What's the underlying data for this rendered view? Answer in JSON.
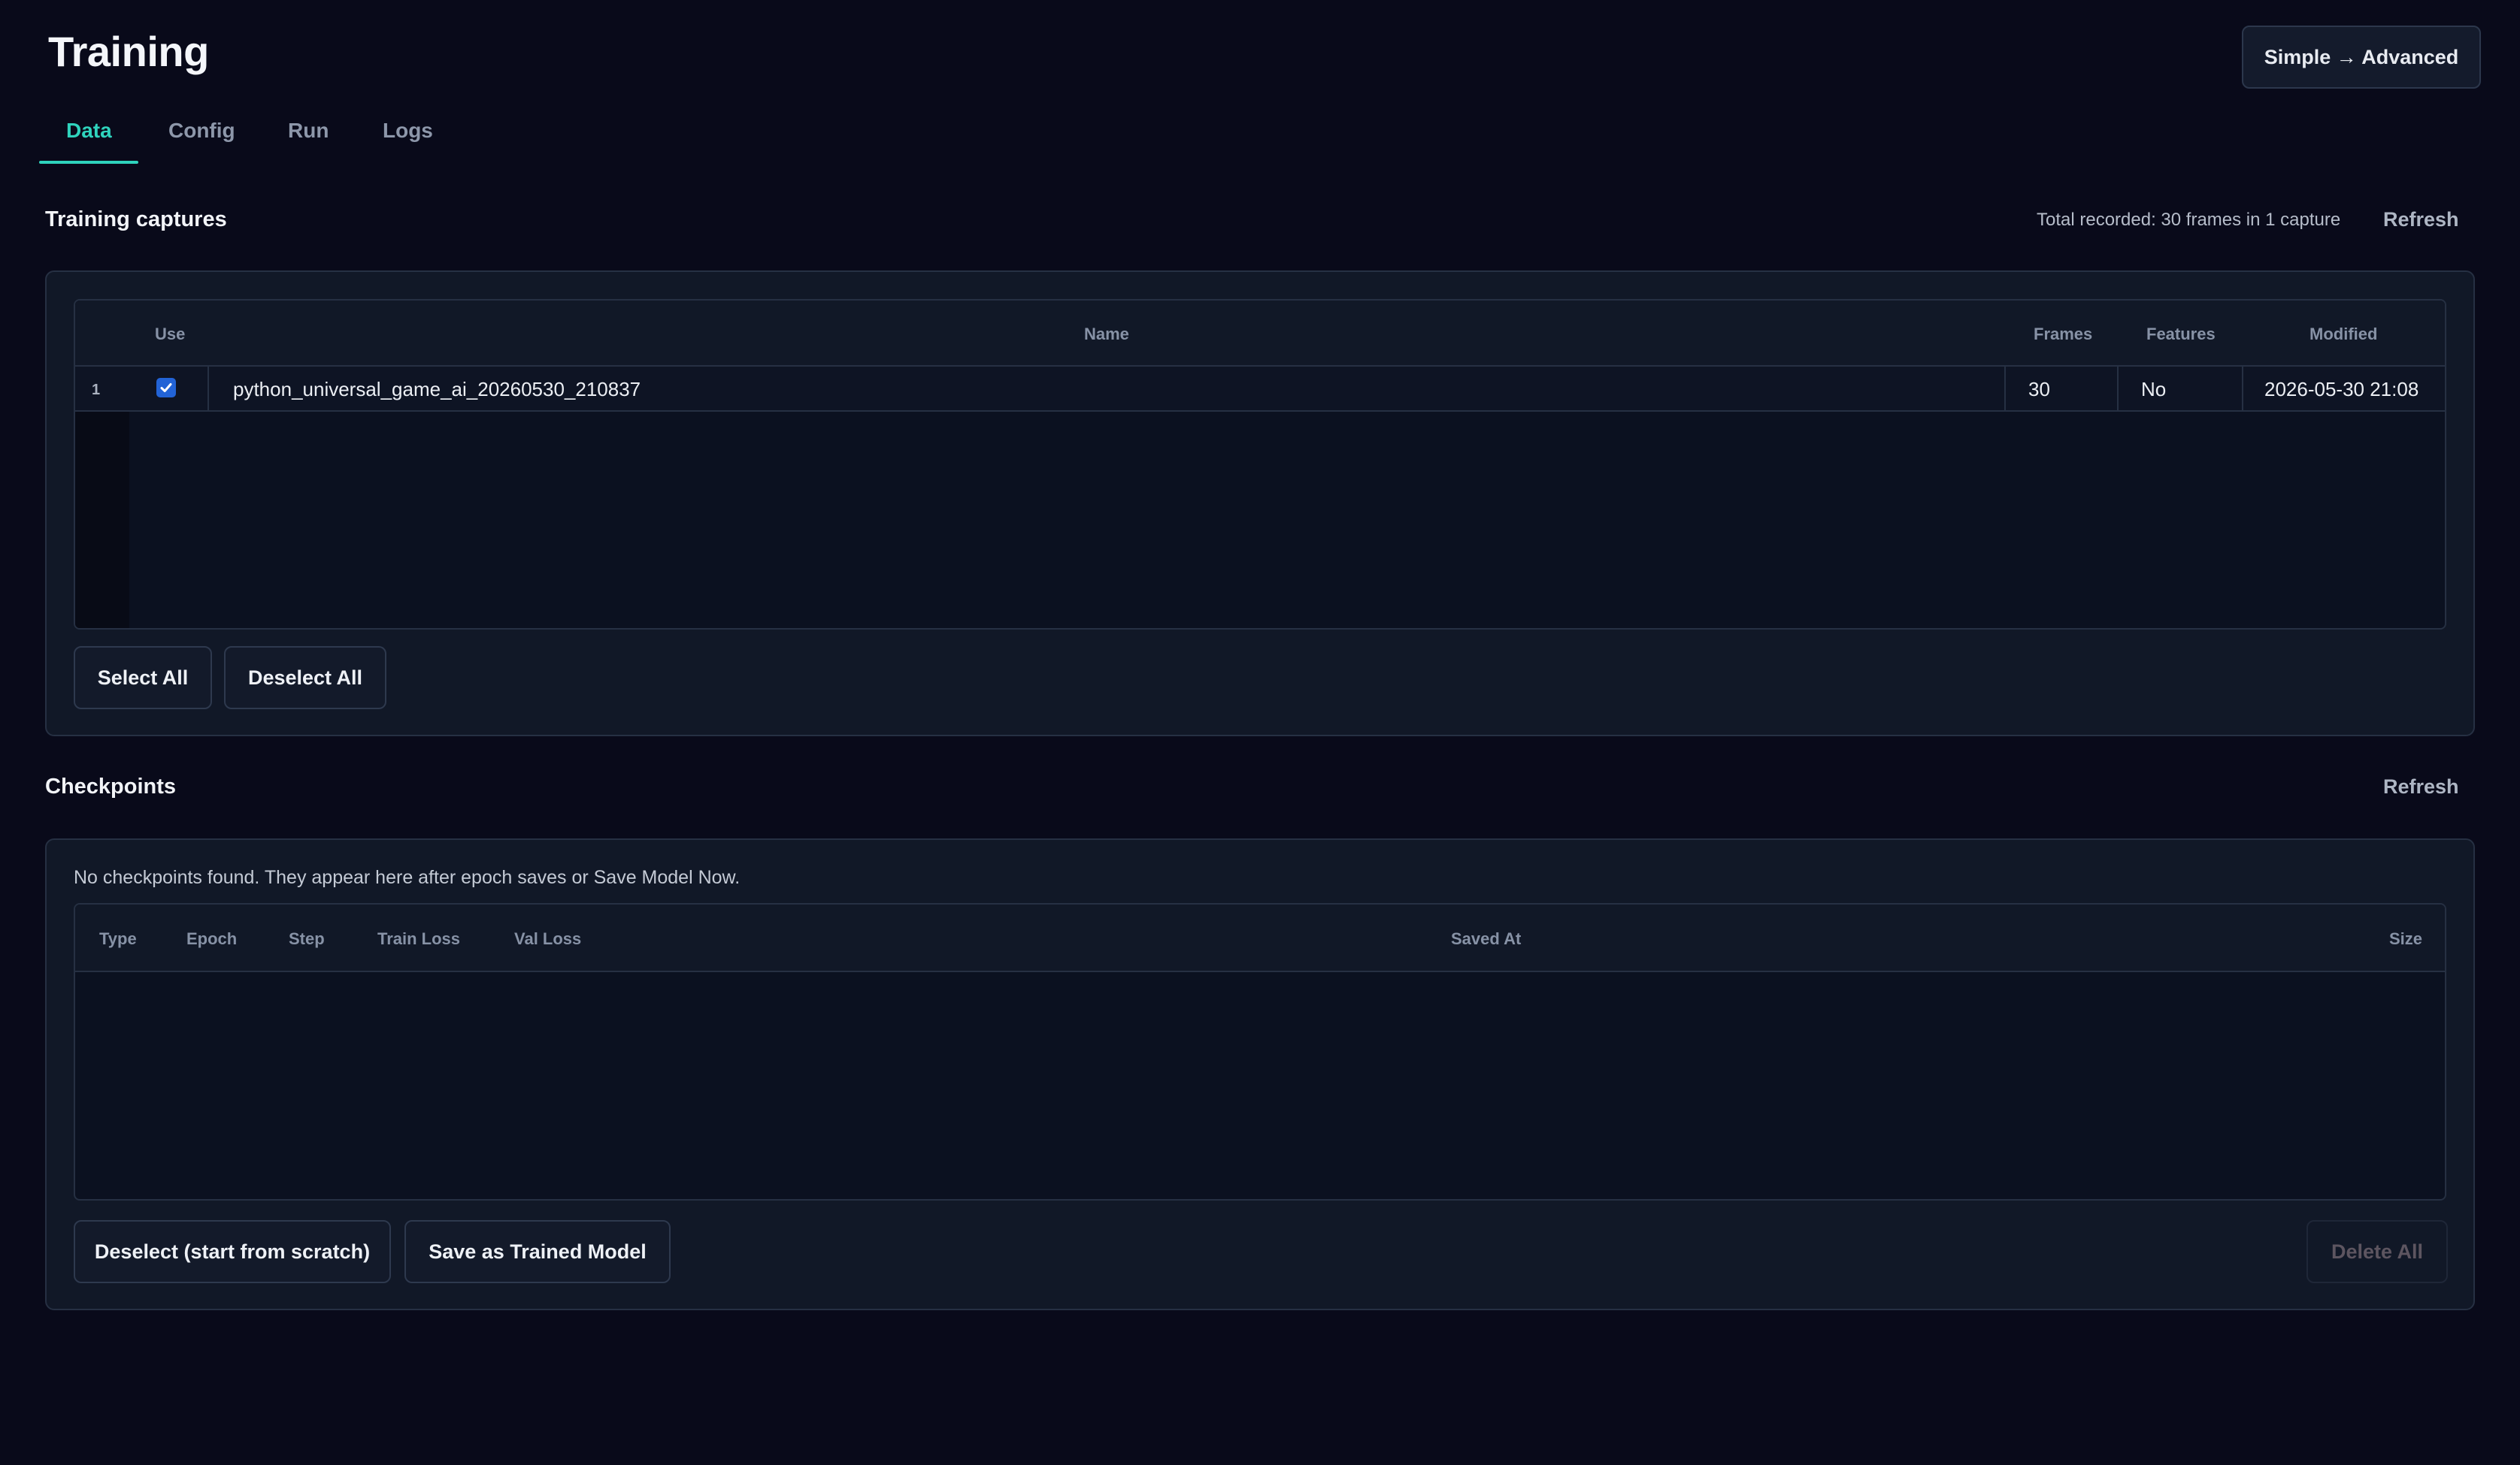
{
  "header": {
    "title": "Training",
    "mode_button": "Simple → Advanced"
  },
  "tabs": [
    {
      "label": "Data",
      "active": true
    },
    {
      "label": "Config",
      "active": false
    },
    {
      "label": "Run",
      "active": false
    },
    {
      "label": "Logs",
      "active": false
    }
  ],
  "captures": {
    "title": "Training captures",
    "summary": "Total recorded: 30 frames in 1 capture",
    "refresh_label": "Refresh",
    "columns": {
      "use": "Use",
      "name": "Name",
      "frames": "Frames",
      "features": "Features",
      "modified": "Modified"
    },
    "rows": [
      {
        "index": "1",
        "checked": true,
        "name": "python_universal_game_ai_20260530_210837",
        "frames": "30",
        "features": "No",
        "modified": "2026-05-30 21:08"
      }
    ],
    "select_all_label": "Select All",
    "deselect_all_label": "Deselect All"
  },
  "checkpoints": {
    "title": "Checkpoints",
    "refresh_label": "Refresh",
    "empty_message": "No checkpoints found. They appear here after epoch saves or Save Model Now.",
    "columns": {
      "type": "Type",
      "epoch": "Epoch",
      "step": "Step",
      "train_loss": "Train Loss",
      "val_loss": "Val Loss",
      "saved_at": "Saved At",
      "size": "Size"
    },
    "deselect_label": "Deselect (start from scratch)",
    "save_trained_label": "Save as Trained Model",
    "delete_all_label": "Delete All"
  },
  "colors": {
    "background": "#090a1a",
    "accent": "#2fd3bd",
    "checkbox": "#2263d6",
    "panel": "#111827"
  },
  "icons": {
    "checkbox": "checkmark-icon"
  }
}
